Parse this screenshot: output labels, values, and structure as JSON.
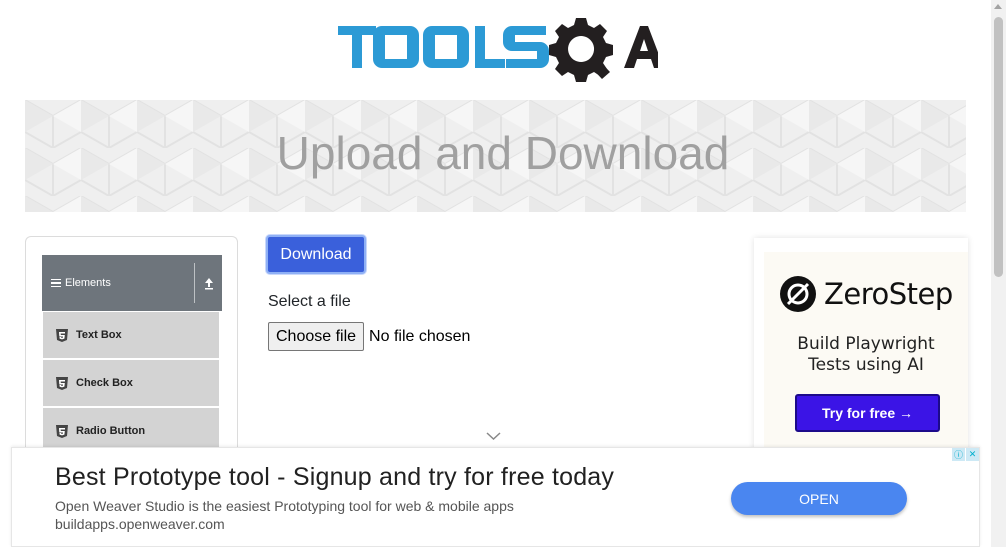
{
  "header": {
    "logo_text": "TOOLSQA",
    "logo_colors": {
      "tools": "#2c9ad5",
      "qa": "#231f20"
    }
  },
  "banner": {
    "title": "Upload and Download"
  },
  "sidebar": {
    "group_label": "Elements",
    "items": [
      {
        "label": "Text Box",
        "icon": "html5-icon"
      },
      {
        "label": "Check Box",
        "icon": "html5-icon"
      },
      {
        "label": "Radio Button",
        "icon": "html5-icon"
      }
    ]
  },
  "main": {
    "download_label": "Download",
    "select_label": "Select a file",
    "choose_file_label": "Choose file",
    "file_status": "No file chosen"
  },
  "right_ad": {
    "brand": "ZeroStep",
    "subtitle_line1": "Build Playwright",
    "subtitle_line2": "Tests using AI",
    "cta": "Try for free →",
    "cta_color": "#3b14e6"
  },
  "bottom_ad": {
    "title": "Best Prototype tool - Signup and try for free today",
    "description": "Open Weaver Studio is the easiest Prototyping tool for web & mobile apps",
    "url": "buildapps.openweaver.com",
    "cta": "OPEN",
    "cta_color": "#4a86f0"
  },
  "colors": {
    "primary_button": "#3a60db",
    "sidebar_header": "#6e757c",
    "sidebar_item": "#d3d3d3"
  }
}
